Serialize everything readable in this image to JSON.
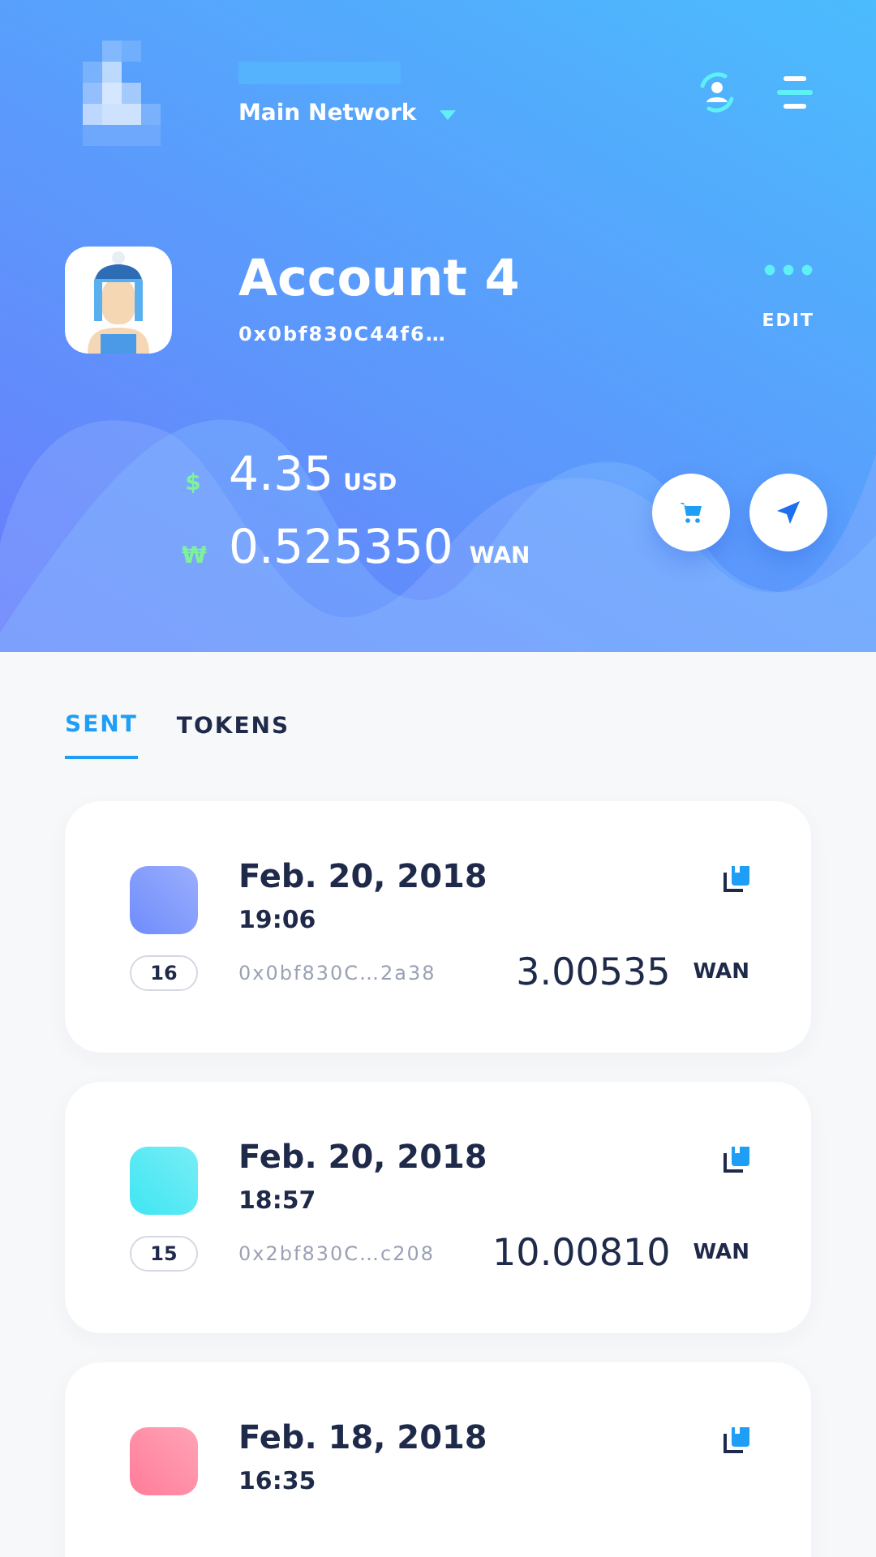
{
  "header": {
    "network": "Main Network",
    "account": {
      "name": "Account 4",
      "address": "0x0bf830C44f6…",
      "edit": "EDIT"
    },
    "balances": [
      {
        "kind": "usd",
        "symbol": "$",
        "amount": "4.35",
        "unit": "USD"
      },
      {
        "kind": "wan",
        "symbol": "₩",
        "amount": "0.525350",
        "unit": "WAN"
      }
    ]
  },
  "tabs": [
    {
      "label": "SENT",
      "selected": true
    },
    {
      "label": "TOKENS",
      "selected": false
    }
  ],
  "transactions": [
    {
      "color": "#6f8cfc",
      "date": "Feb. 20, 2018",
      "time": "19:06",
      "nonce": "16",
      "address": "0x0bf830C…2a38",
      "amount": "3.00535",
      "unit": "WAN"
    },
    {
      "color": "#3ee6f2",
      "date": "Feb. 20, 2018",
      "time": "18:57",
      "nonce": "15",
      "address": "0x2bf830C…c208",
      "amount": "10.00810",
      "unit": "WAN"
    },
    {
      "color": "#ff7c98",
      "date": "Feb. 18, 2018",
      "time": "16:35"
    }
  ]
}
